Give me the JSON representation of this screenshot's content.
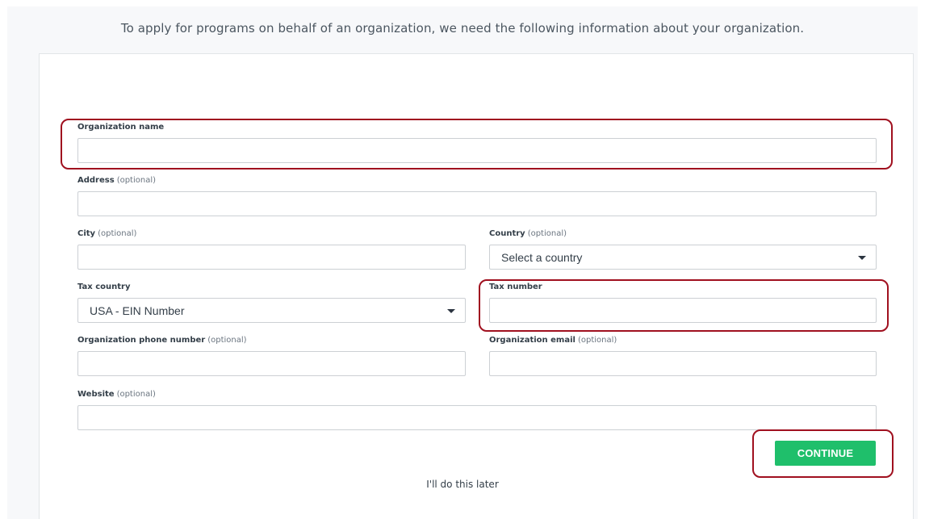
{
  "intro_text": "To apply for programs on behalf of an organization, we need the following information about your organization.",
  "optional_tag": "(optional)",
  "fields": {
    "organization_name": {
      "label": "Organization name",
      "value": ""
    },
    "address": {
      "label": "Address",
      "value": ""
    },
    "city": {
      "label": "City",
      "value": ""
    },
    "country": {
      "label": "Country",
      "selected": "Select a country"
    },
    "tax_country": {
      "label": "Tax country",
      "selected": "USA - EIN Number"
    },
    "tax_number": {
      "label": "Tax number",
      "value": ""
    },
    "phone": {
      "label": "Organization phone number",
      "value": ""
    },
    "email": {
      "label": "Organization email",
      "value": ""
    },
    "website": {
      "label": "Website",
      "value": ""
    }
  },
  "buttons": {
    "continue_label": "CONTINUE",
    "later_label": "I'll do this later"
  },
  "colors": {
    "primary_button": "#1fbf6b",
    "highlight_outline": "#a0101f",
    "page_background": "#f7f8fa"
  }
}
